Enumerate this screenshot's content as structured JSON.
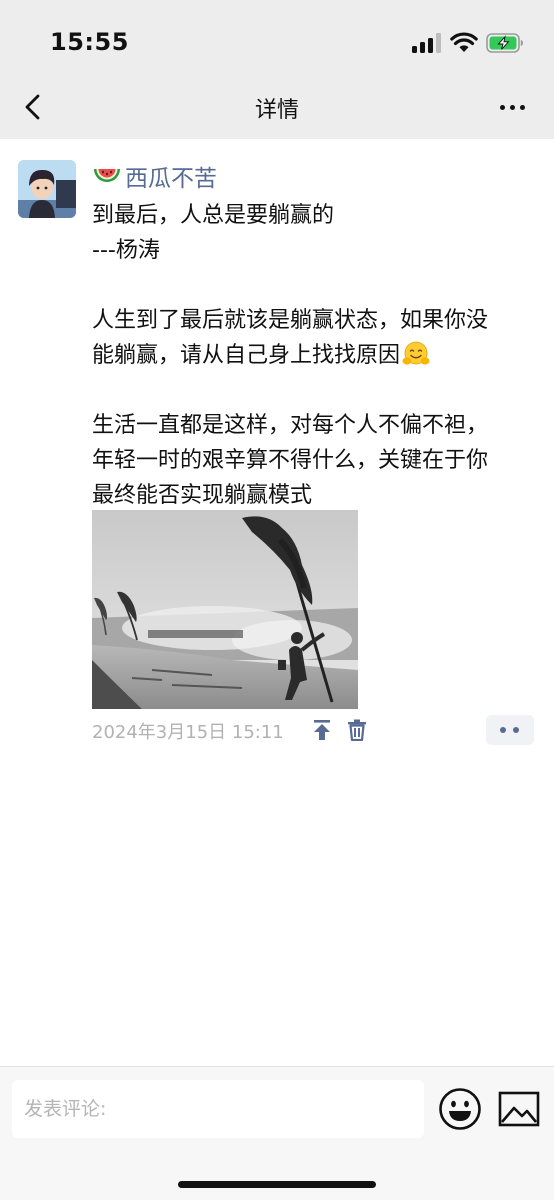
{
  "status_bar": {
    "time": "15:55",
    "battery_color": "#34c759"
  },
  "nav": {
    "title": "详情"
  },
  "post": {
    "author": "西瓜不苦",
    "author_color": "#576b95",
    "lines": [
      "到最后，人总是要躺赢的",
      "---杨涛",
      "",
      "人生到了最后就该是躺赢状态，如果你没",
      "能躺赢，请从自己身上找找原因",
      "",
      "生活一直都是这样，对每个人不偏不袒，",
      "年轻一时的艰辛算不得什么，关键在于你",
      "最终能否实现躺赢模式"
    ],
    "emoji": "hugging-face-emoji",
    "photo": "black-and-white photo of a man bracing against wind beside a bent tree on a stormy shore",
    "timestamp": "2024年3月15日 15:11"
  },
  "comment": {
    "placeholder": "发表评论:"
  }
}
